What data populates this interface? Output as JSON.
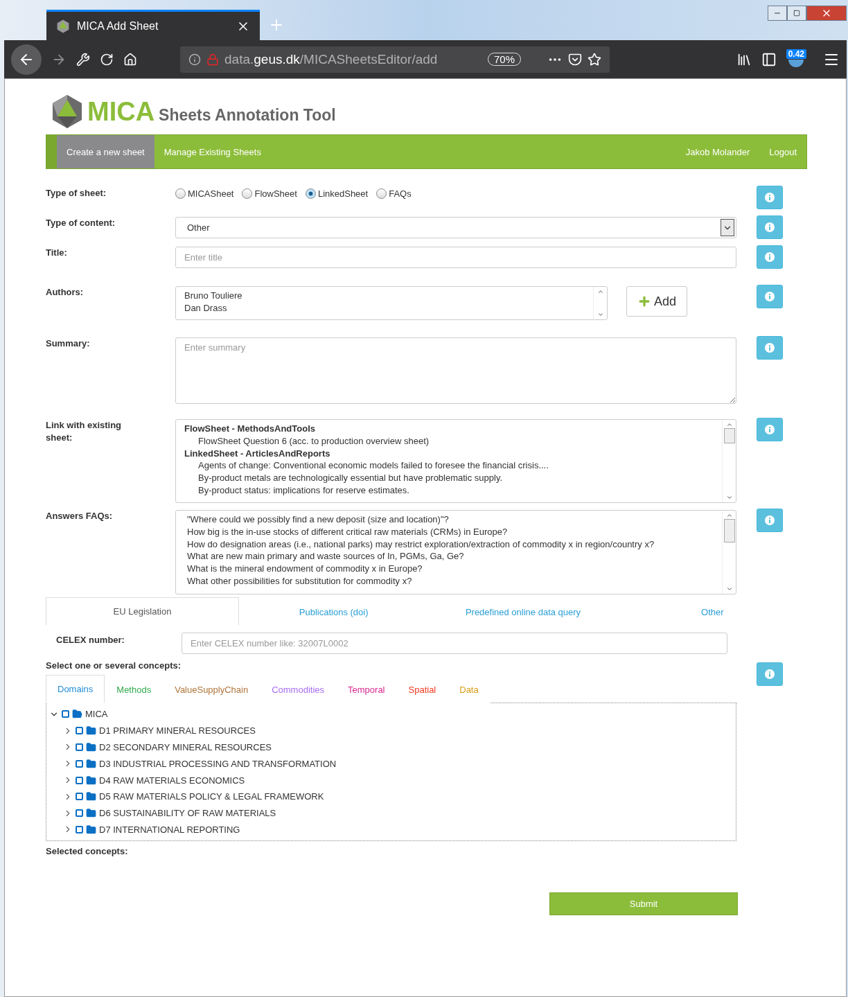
{
  "browser": {
    "tab_title": "MICA Add Sheet",
    "url_prefix": "data.",
    "url_domain": "geus.dk",
    "url_path": "/MICASheetsEditor/add",
    "zoom": "70%",
    "badge": "0.42"
  },
  "header": {
    "logo": "MICA",
    "subtitle": "Sheets Annotation Tool"
  },
  "nav": {
    "items": [
      {
        "label": "Create a new sheet",
        "selected": true
      },
      {
        "label": "Manage Existing Sheets",
        "selected": false
      }
    ],
    "user": "Jakob Molander",
    "logout": "Logout"
  },
  "type_of_sheet": {
    "label": "Type of sheet:",
    "options": [
      {
        "label": "MICASheet",
        "selected": false
      },
      {
        "label": "FlowSheet",
        "selected": false
      },
      {
        "label": "LinkedSheet",
        "selected": true
      },
      {
        "label": "FAQs",
        "selected": false
      }
    ]
  },
  "type_of_content": {
    "label": "Type of content:",
    "value": "Other"
  },
  "title": {
    "label": "Title:",
    "placeholder": "Enter title"
  },
  "authors": {
    "label": "Authors:",
    "items": [
      "Bruno Touliere",
      "Dan Drass"
    ],
    "add_button": "Add"
  },
  "summary": {
    "label": "Summary:",
    "placeholder": "Enter summary"
  },
  "link": {
    "label": "Link with existing sheet:",
    "groups": [
      {
        "title": "FlowSheet - MethodsAndTools",
        "items": [
          "FlowSheet Question 6 (acc. to production overview sheet)"
        ]
      },
      {
        "title": "LinkedSheet - ArticlesAndReports",
        "items": [
          "Agents of change: Conventional economic models failed to foresee the financial crisis....",
          "By-product metals are technologically essential but have problematic supply.",
          "By-product status: implications for reserve estimates."
        ]
      }
    ]
  },
  "faqs": {
    "label": "Answers FAQs:",
    "items": [
      "\"Where could we possibly find a new deposit (size and location)\"?",
      "How big is the in-use stocks of different critical raw materials (CRMs) in Europe?",
      "How do designation areas (i.e., national parks) may restrict exploration/extraction of commodity x in region/country x?",
      "What are new main primary and waste sources of In, PGMs, Ga, Ge?",
      "What is the mineral endowment of commodity x in Europe?",
      "What other possibilities for substitution for commodity x?"
    ]
  },
  "resource_tabs": [
    {
      "label": "EU Legislation",
      "selected": true
    },
    {
      "label": "Publications (doi)",
      "selected": false
    },
    {
      "label": "Predefined online data query",
      "selected": false
    },
    {
      "label": "Other",
      "selected": false
    }
  ],
  "celex": {
    "label": "CELEX number:",
    "placeholder": "Enter CELEX number like: 32007L0002"
  },
  "concepts": {
    "label": "Select one or several concepts:",
    "tabs": [
      {
        "label": "Domains",
        "color": "#1f8dd6",
        "selected": true
      },
      {
        "label": "Methods",
        "color": "#2eaa4a",
        "selected": false
      },
      {
        "label": "ValueSupplyChain",
        "color": "#b0743a",
        "selected": false
      },
      {
        "label": "Commodities",
        "color": "#a66cf0",
        "selected": false
      },
      {
        "label": "Temporal",
        "color": "#d6278e",
        "selected": false
      },
      {
        "label": "Spatial",
        "color": "#f2361d",
        "selected": false
      },
      {
        "label": "Data",
        "color": "#d99a12",
        "selected": false
      }
    ],
    "tree": {
      "label": "MICA",
      "expanded": true,
      "checked": false,
      "children": [
        {
          "label": "D1 PRIMARY MINERAL RESOURCES",
          "expanded": false,
          "checked": false
        },
        {
          "label": "D2 SECONDARY MINERAL RESOURCES",
          "expanded": false,
          "checked": false
        },
        {
          "label": "D3 INDUSTRIAL PROCESSING AND TRANSFORMATION",
          "expanded": false,
          "checked": false
        },
        {
          "label": "D4 RAW MATERIALS ECONOMICS",
          "expanded": false,
          "checked": false
        },
        {
          "label": "D5 RAW MATERIALS POLICY & LEGAL FRAMEWORK",
          "expanded": false,
          "checked": false
        },
        {
          "label": "D6 SUSTAINABILITY OF RAW MATERIALS",
          "expanded": false,
          "checked": false
        },
        {
          "label": "D7 INTERNATIONAL REPORTING",
          "expanded": false,
          "checked": false
        }
      ]
    }
  },
  "selected_concepts": {
    "label": "Selected concepts:"
  },
  "submit": "Submit"
}
